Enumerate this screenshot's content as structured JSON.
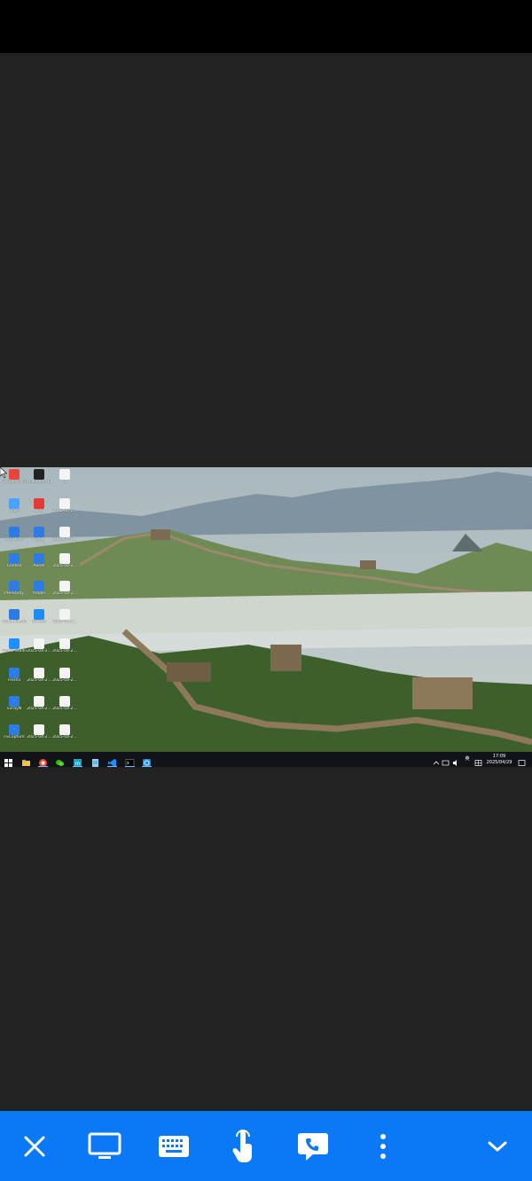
{
  "remote_desktop": {
    "icons": [
      {
        "label": "Google Chrome",
        "icon": "chrome-icon"
      },
      {
        "label": "Wallpaper Engine",
        "icon": "wallpaper-engine-icon"
      },
      {
        "label": "1",
        "icon": "file-icon"
      },
      {
        "label": "Clash",
        "icon": "clash-icon"
      },
      {
        "label": "WPS",
        "icon": "wps-icon"
      },
      {
        "label": "2025-04-2...",
        "icon": "file-icon"
      },
      {
        "label": "AnyDesk",
        "icon": "app-icon"
      },
      {
        "label": "Edge",
        "icon": "app-icon"
      },
      {
        "label": "2025-04-2...",
        "icon": "file-icon"
      },
      {
        "label": "Control",
        "icon": "app-icon"
      },
      {
        "label": "Aeriel",
        "icon": "app-icon"
      },
      {
        "label": "2025-04-2...",
        "icon": "file-icon"
      },
      {
        "label": "PHPStudy",
        "icon": "app-icon"
      },
      {
        "label": "Adobe",
        "icon": "app-icon"
      },
      {
        "label": "2025-04-2...",
        "icon": "file-icon"
      },
      {
        "label": "Visual Studio",
        "icon": "app-icon"
      },
      {
        "label": "ToDesk",
        "icon": "todesk-icon"
      },
      {
        "label": "2025-04-2...",
        "icon": "file-icon"
      },
      {
        "label": "Visual Studio Code",
        "icon": "vscode-icon"
      },
      {
        "label": "2025-04-2...",
        "icon": "file-icon"
      },
      {
        "label": "2025-04-2...",
        "icon": "file-icon"
      },
      {
        "label": "Feishu",
        "icon": "app-icon"
      },
      {
        "label": "2025-04-2...",
        "icon": "file-icon"
      },
      {
        "label": "2025-04-2...",
        "icon": "file-icon"
      },
      {
        "label": "v2rayN",
        "icon": "app-icon"
      },
      {
        "label": "2025-04-2...",
        "icon": "file-icon"
      },
      {
        "label": "2025-04-2...",
        "icon": "file-icon"
      },
      {
        "label": "FSCapture",
        "icon": "app-icon"
      },
      {
        "label": "2025-04-2...",
        "icon": "file-icon"
      },
      {
        "label": "2025-04-2...",
        "icon": "file-icon"
      }
    ],
    "taskbar": {
      "apps": [
        "start-icon",
        "file-explorer-icon",
        "browser-icon",
        "wechat-icon",
        "terminal-icon",
        "notepad-icon",
        "vscode-icon",
        "console-icon",
        "todesk-icon"
      ],
      "tray": {
        "ime": "英",
        "time": "17:09",
        "date": "2025/04/29"
      }
    }
  },
  "toolbar": {
    "buttons": [
      {
        "name": "close-button",
        "icon": "close-icon"
      },
      {
        "name": "screen-button",
        "icon": "monitor-icon"
      },
      {
        "name": "keyboard-button",
        "icon": "keyboard-icon"
      },
      {
        "name": "touch-mode-button",
        "icon": "touch-icon"
      },
      {
        "name": "call-button",
        "icon": "call-chat-icon"
      },
      {
        "name": "more-button",
        "icon": "more-vertical-icon"
      },
      {
        "name": "collapse-button",
        "icon": "chevron-down-icon"
      }
    ]
  },
  "colors": {
    "toolbar_bg": "#0b78f5",
    "background": "#222222",
    "statusbar": "#000000"
  }
}
